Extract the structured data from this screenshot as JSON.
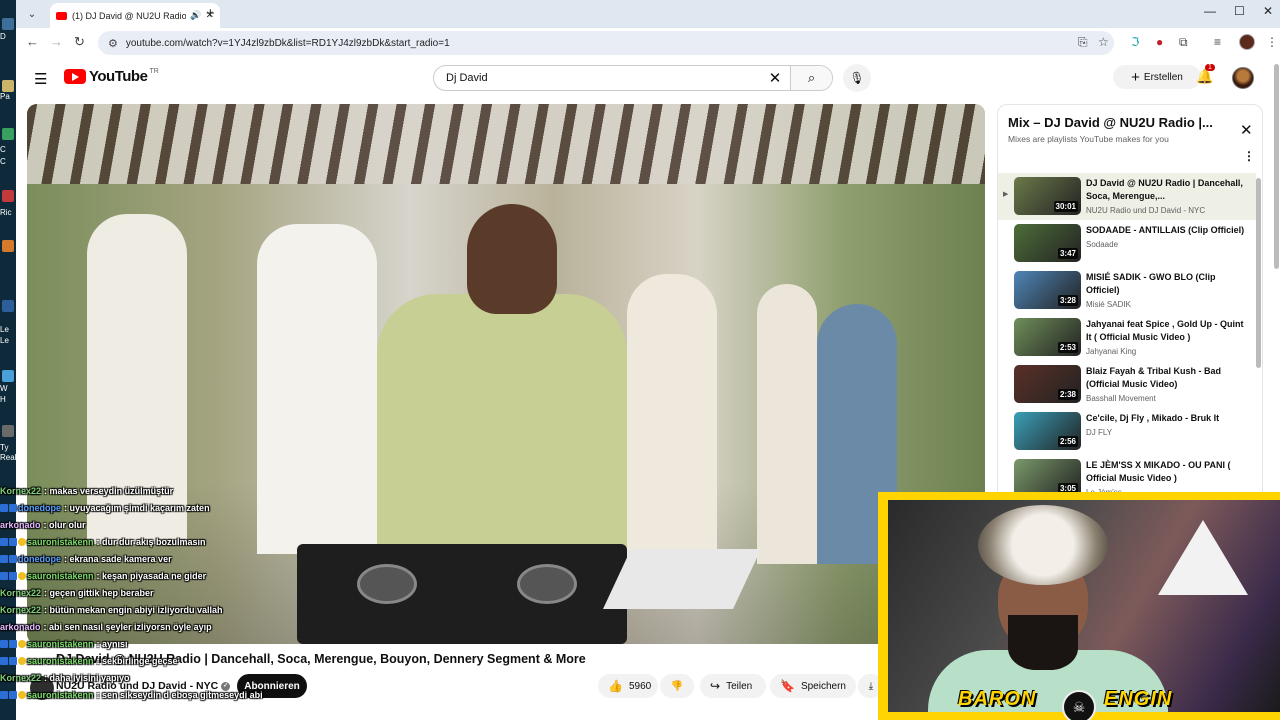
{
  "desktop": {
    "labels": [
      "D",
      "Pa",
      "C",
      "C",
      "Ric",
      "Le",
      "Le",
      "W",
      "H",
      "Ty",
      "Real"
    ]
  },
  "browser": {
    "tab_title": "(1) DJ David @ NU2U Radio",
    "url": "youtube.com/watch?v=1YJ4zl9zbDk&list=RD1YJ4zl9zbDk&start_radio=1"
  },
  "youtube": {
    "logo_text": "YouTube",
    "logo_region": "TR",
    "search_value": "Dj David",
    "create_label": "Erstellen",
    "notif_count": "1"
  },
  "video": {
    "title": "DJ David @ NU2U Radio | Dancehall, Soca, Merengue, Bouyon, Dennery Segment & More",
    "channel": "NU2U Radio und DJ David - NYC",
    "subscribe_label": "Abonnieren",
    "likes": "5960",
    "share_label": "Teilen",
    "save_label": "Speichern"
  },
  "playlist": {
    "title": "Mix – DJ David @ NU2U Radio |...",
    "subtitle": "Mixes are playlists YouTube makes for you",
    "items": [
      {
        "title": "DJ David @ NU2U Radio | Dancehall, Soca, Merengue,...",
        "channel": "NU2U Radio und DJ David - NYC",
        "duration": "30:01",
        "thumb": "#6b7a4a"
      },
      {
        "title": "SODAADE - ANTILLAIS (Clip Officiel)",
        "channel": "Sodaade",
        "duration": "3:47",
        "thumb": "#4e6e3a"
      },
      {
        "title": "MISIÉ SADIK - GWO BLO (Clip Officiel)",
        "channel": "Misié SADIK",
        "duration": "3:28",
        "thumb": "#4f86b8"
      },
      {
        "title": "Jahyanai feat Spice , Gold Up - Quint It ( Official Music Video )",
        "channel": "Jahyanai King",
        "duration": "2:53",
        "thumb": "#6f8f5a"
      },
      {
        "title": "Blaiz Fayah & Tribal Kush - Bad (Official Music Video)",
        "channel": "Basshall Movement",
        "duration": "2:38",
        "thumb": "#5a3028"
      },
      {
        "title": "Ce'cile, Dj Fly , Mikado - Bruk It",
        "channel": "DJ FLY",
        "duration": "2:56",
        "thumb": "#3aa0b8"
      },
      {
        "title": "LE JÈM'SS X MIKADO - OU PANI ( Official Music Video )",
        "channel": "Le Jèm'ss",
        "duration": "3:05",
        "thumb": "#7a9a6a"
      }
    ]
  },
  "chat": [
    {
      "user": "Kornex22",
      "text": ": makas verseydin üzülmüştür",
      "badge": "none"
    },
    {
      "user": "donedope",
      "text": ": uyuyacağım şimdi kaçarım zaten",
      "badge": "blue"
    },
    {
      "user": "arkonado",
      "text": ": olur olur",
      "badge": "none"
    },
    {
      "user": "sauronistakenn",
      "text": ": dur dur akış bozulmasın",
      "badge": "both"
    },
    {
      "user": "donedope",
      "text": ": ekrana sade kamera ver",
      "badge": "blue"
    },
    {
      "user": "sauronistakenn",
      "text": ": keşan piyasada ne gider",
      "badge": "both"
    },
    {
      "user": "Kornex22",
      "text": ": geçen gittik hep beraber",
      "badge": "none"
    },
    {
      "user": "Kornex22",
      "text": ": bütün mekan engin abiyi izliyordu vallah",
      "badge": "none"
    },
    {
      "user": "arkonado",
      "text": ": abi sen nasıl şeyler izliyorsn öyle ayıp",
      "badge": "none"
    },
    {
      "user": "sauronistakenn",
      "text": ": aynısı",
      "badge": "both"
    },
    {
      "user": "sauronistakenn",
      "text": ": sekbirlinge geçse",
      "badge": "both"
    },
    {
      "user": "Kornex22",
      "text": ": daha iyisini yapıyo",
      "badge": "none"
    },
    {
      "user": "sauronistakenn",
      "text": ": sen sikseydin d eboşa gitmeseydi abi",
      "badge": "both"
    }
  ],
  "webcam": {
    "name_left": "BARON",
    "name_right": "ENGIN"
  }
}
